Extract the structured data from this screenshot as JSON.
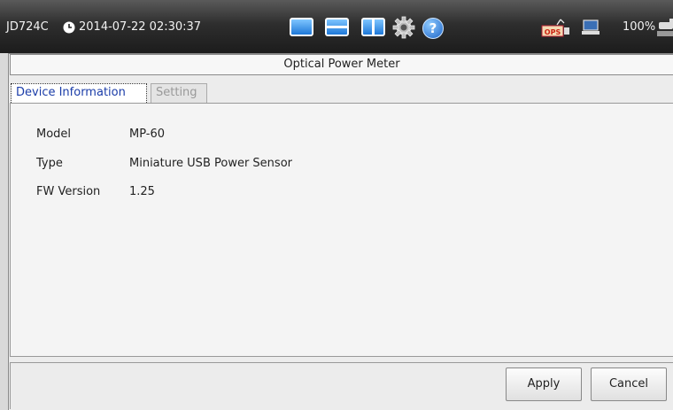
{
  "status_bar": {
    "device_name": "JD724C",
    "datetime": "2014-07-22 02:30:37",
    "battery_level": "100%",
    "icons": {
      "clock": "clock-icon",
      "layout_single": "single-view-icon",
      "layout_split_horizontal": "split-horizontal-view-icon",
      "layout_split_vertical": "split-vertical-view-icon",
      "settings": "gear-icon",
      "help": "help-icon",
      "ops": "ops-icon",
      "connection": "laptop-icon",
      "power": "power-plug-icon"
    },
    "ops_label": "OPS",
    "help_glyph": "?"
  },
  "window": {
    "title": "Optical Power Meter"
  },
  "tabs": [
    {
      "label": "Device Information",
      "active": true
    },
    {
      "label": "Setting",
      "active": false
    }
  ],
  "device_info": {
    "rows": [
      {
        "label": "Model",
        "value": "MP-60"
      },
      {
        "label": "Type",
        "value": "Miniature USB Power Sensor"
      },
      {
        "label": "FW Version",
        "value": "1.25"
      }
    ]
  },
  "buttons": {
    "apply": "Apply",
    "cancel": "Cancel"
  },
  "colors": {
    "active_tab_text": "#1a3ca8",
    "inactive_tab_text": "#999999",
    "status_bar": "#2e2e2e",
    "layout_button": "#1e78d8"
  }
}
